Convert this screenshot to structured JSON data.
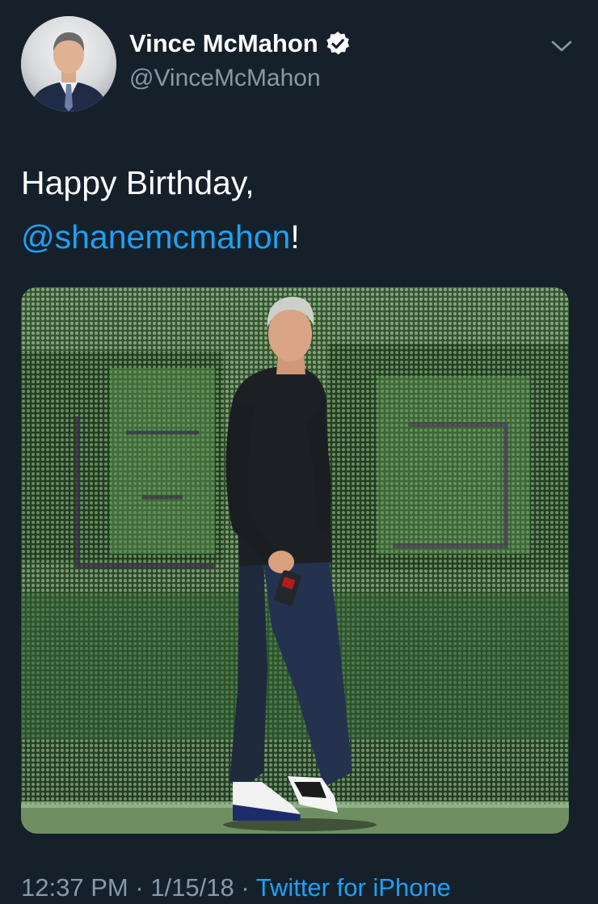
{
  "author": {
    "display_name": "Vince McMahon",
    "handle": "@VinceMcMahon",
    "verified": true,
    "avatar": "profile-photo"
  },
  "tweet": {
    "text_line1": "Happy Birthday,",
    "mention": "@shanemcmahon",
    "text_suffix": "!",
    "media": "photo-man-walking-on-stage-led-wall"
  },
  "meta": {
    "time": "12:37 PM",
    "separator1": " · ",
    "date": "1/15/18",
    "separator2": " · ",
    "source": "Twitter for iPhone"
  },
  "icons": {
    "verified": "verified-badge-icon",
    "menu": "chevron-down-icon"
  },
  "colors": {
    "background": "#15202b",
    "accent": "#1da1f2",
    "secondary_text": "#8899a6",
    "primary_text": "#ffffff"
  }
}
